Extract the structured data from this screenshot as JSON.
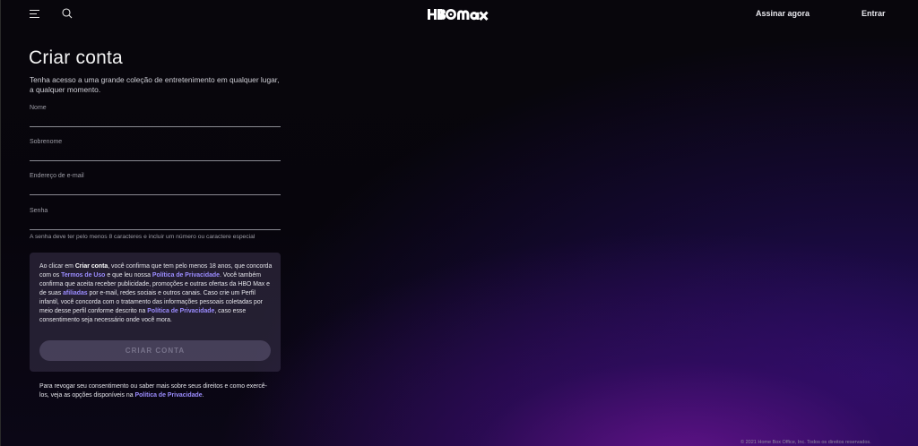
{
  "header": {
    "logo_text": "HBO max",
    "signup_label": "Assinar agora",
    "signin_label": "Entrar"
  },
  "form": {
    "title": "Criar conta",
    "subtitle": "Tenha acesso a uma grande coleção de entretenimento em qualquer lugar, a qualquer momento.",
    "fields": [
      {
        "label": "Nome",
        "value": ""
      },
      {
        "label": "Sobrenome",
        "value": ""
      },
      {
        "label": "Endereço de e-mail",
        "value": ""
      },
      {
        "label": "Senha",
        "value": ""
      }
    ],
    "password_hint": "A senha deve ter pelo menos 8 caracteres e incluir um número ou caractere especial",
    "consent": {
      "p1": "Ao clicar em ",
      "bold_create": "Criar conta",
      "p2": ", você confirma que tem pelo menos 18 anos, que concorda com os ",
      "link_terms": "Termos de Uso",
      "p3": " e que leu nossa ",
      "link_privacy_1": "Política de Privacidade",
      "p4": ". Você também confirma que aceita receber publicidade, promoções e outras ofertas da HBO Max e de suas ",
      "link_affiliates": "afiliadas",
      "p5": " por e-mail, redes sociais e outros canais. Caso crie um Perfil infantil, você concorda com o tratamento das informações pessoais coletadas por meio desse perfil conforme descrito na ",
      "link_privacy_2": "Política de Privacidade",
      "p6": ", caso esse consentimento seja necessário onde você mora."
    },
    "submit_label": "CRIAR CONTA",
    "revoke": {
      "p1": "Para revogar seu consentimento ou saber mais sobre seus direitos e como exercê-los, veja as opções disponíveis na ",
      "link_privacy": "Política de Privacidade",
      "p2": "."
    }
  },
  "footer": {
    "copyright": "© 2021 Home Box Office, Inc. Todos os direitos reservados."
  }
}
